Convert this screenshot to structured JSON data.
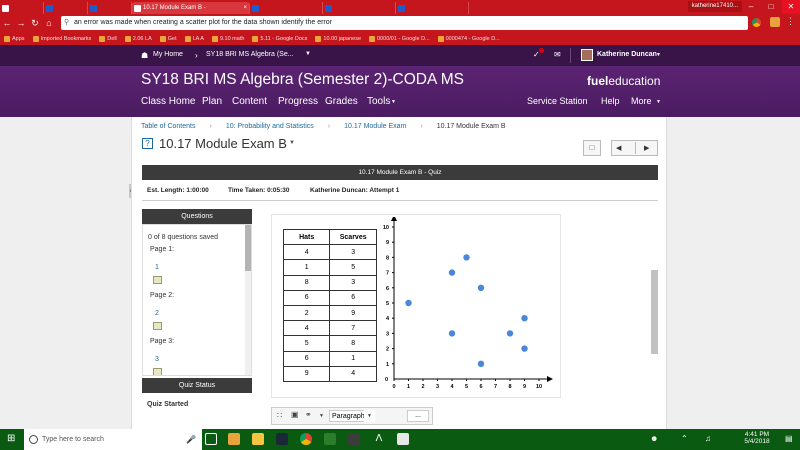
{
  "browser": {
    "tabs": [
      {
        "label": "",
        "fav": "fueled-icon"
      },
      {
        "label": "",
        "fav": "doc"
      },
      {
        "label": "",
        "fav": "doc"
      },
      {
        "label": "10.17 Module Exam B - ",
        "fav": "fueled-icon",
        "active": true
      },
      {
        "label": "",
        "fav": "doc"
      },
      {
        "label": "",
        "fav": "doc"
      },
      {
        "label": "",
        "fav": "doc"
      }
    ],
    "profile_name": "katherine17410...",
    "address_text": "an error was made when creating a scatter plot for the data shown identify the error",
    "bookmarks": [
      "Apps",
      "Imported Bookmarks",
      "Dell",
      "2.06 LA",
      "Get",
      "LA A",
      "9.10 math",
      "5.11 - Google Docs",
      "10.00 japanese",
      "0000/01 - Google D...",
      "0000474 - Google D..."
    ]
  },
  "site": {
    "top_nav": {
      "my_home": "My Home",
      "course_menu": "SY18 BRI MS Algebra (Se...",
      "user_name": "Katherine Duncan"
    },
    "course_title": "SY18 BRI MS Algebra (Semester 2)-CODA MS",
    "logo": {
      "bold": "fuel",
      "light": "education"
    },
    "nav": [
      "Class Home",
      "Plan",
      "Content",
      "Progress",
      "Grades",
      "Tools"
    ],
    "nav_right": [
      "Service Station",
      "Help",
      "More"
    ]
  },
  "breadcrumb": [
    "Table of Contents",
    "10: Probability and Statistics",
    "10.17 Module Exam",
    "10.17 Module Exam B"
  ],
  "page_title": "10.17 Module Exam B",
  "quiz_bar": "10.17 Module Exam B - Quiz",
  "quiz_info": {
    "est_length": "Est. Length: 1:00:00",
    "time_taken": "Time Taken: 0:05:30",
    "attempt": "Katherine Duncan: Attempt 1"
  },
  "sidebar": {
    "header": "Questions",
    "saved": "0 of 8 questions saved",
    "pages": [
      {
        "label": "Page 1:",
        "q": "1"
      },
      {
        "label": "Page 2:",
        "q": "2"
      },
      {
        "label": "Page 3:",
        "q": "3"
      }
    ],
    "status_header": "Quiz Status",
    "status_text": "Quiz Started"
  },
  "table": {
    "headers": [
      "Hats",
      "Scarves"
    ],
    "rows": [
      [
        4,
        3
      ],
      [
        1,
        5
      ],
      [
        8,
        3
      ],
      [
        6,
        6
      ],
      [
        2,
        9
      ],
      [
        4,
        7
      ],
      [
        5,
        8
      ],
      [
        6,
        1
      ],
      [
        9,
        4
      ]
    ]
  },
  "chart_data": {
    "type": "scatter",
    "points": [
      [
        1,
        5
      ],
      [
        4,
        3
      ],
      [
        4,
        7
      ],
      [
        5,
        8
      ],
      [
        6,
        6
      ],
      [
        6,
        1
      ],
      [
        8,
        3
      ],
      [
        9,
        4
      ],
      [
        9,
        2
      ]
    ],
    "xlim": [
      0,
      10
    ],
    "ylim": [
      0,
      10
    ],
    "xticks": [
      0,
      1,
      2,
      3,
      4,
      5,
      6,
      7,
      8,
      9,
      10
    ],
    "yticks": [
      0,
      1,
      2,
      3,
      4,
      5,
      6,
      7,
      8,
      9,
      10
    ],
    "grid": false,
    "point_color": "#4a86d9"
  },
  "editor": {
    "style_select": "Paragraph",
    "more": "..."
  },
  "taskbar": {
    "search_placeholder": "Type here to search",
    "time": "4:41 PM",
    "date": "5/4/2018"
  },
  "colors": {
    "browser_red": "#c4161c",
    "header_purple": "#4b1c61",
    "taskbar_green": "#0b5a12"
  }
}
